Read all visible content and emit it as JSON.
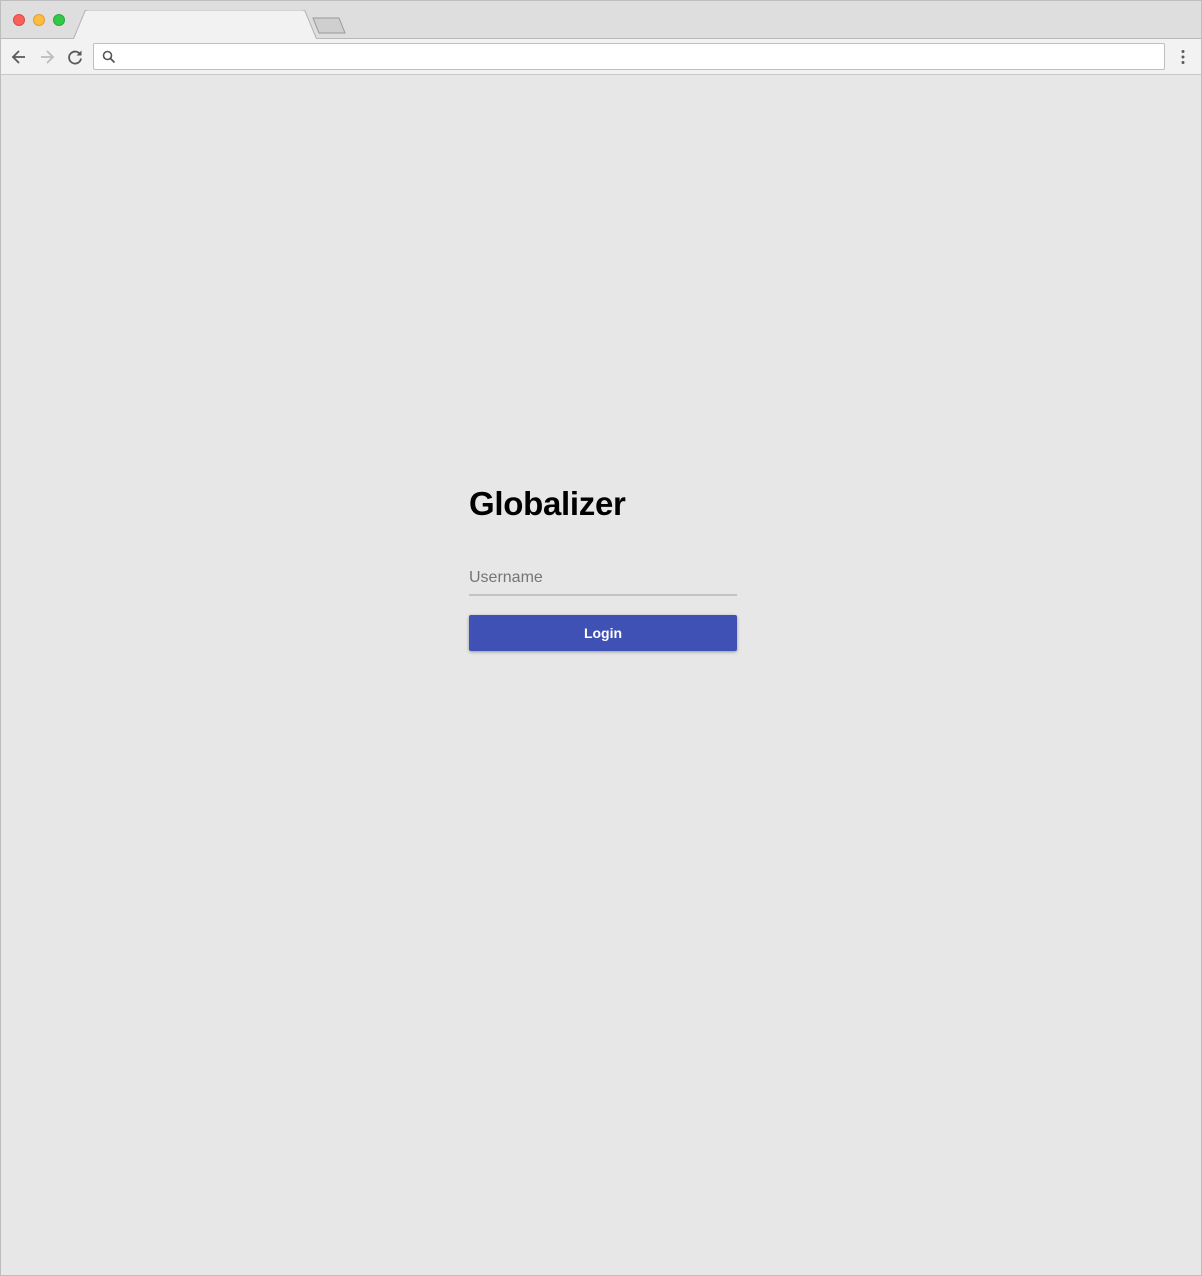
{
  "browser": {
    "address_bar": {
      "value": "",
      "placeholder": ""
    },
    "icons": {
      "back": "arrow-left-icon",
      "forward": "arrow-right-icon",
      "reload": "reload-icon",
      "search": "search-icon",
      "menu": "more-vert-icon"
    }
  },
  "login": {
    "brand": "Globalizer",
    "username_placeholder": "Username",
    "username_value": "",
    "button_label": "Login"
  },
  "colors": {
    "page_background": "#e7e7e7",
    "primary": "#3f51b5",
    "traffic_red": "#fc605c",
    "traffic_yellow": "#fdbc40",
    "traffic_green": "#34c84a"
  }
}
